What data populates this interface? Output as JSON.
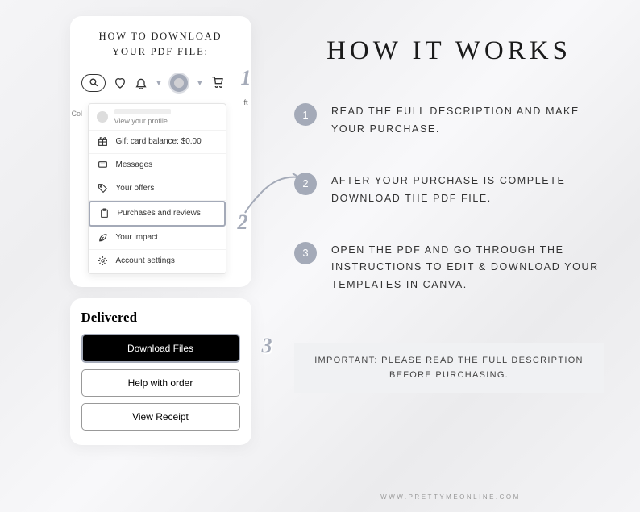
{
  "leftCard": {
    "title_line1": "HOW TO DOWNLOAD",
    "title_line2": "YOUR PDF FILE:",
    "behindText": "ift",
    "colLabel": "Col"
  },
  "dropdown": {
    "viewProfile": "View your profile",
    "giftCard": "Gift card balance: $0.00",
    "messages": "Messages",
    "offers": "Your offers",
    "purchases": "Purchases and reviews",
    "impact": "Your impact",
    "settings": "Account settings"
  },
  "delivered": {
    "title": "Delivered",
    "download": "Download Files",
    "help": "Help with order",
    "receipt": "View Receipt"
  },
  "main": {
    "title": "HOW IT WORKS",
    "steps": [
      "READ THE FULL DESCRIPTION AND MAKE YOUR PURCHASE.",
      "AFTER YOUR PURCHASE IS COMPLETE DOWNLOAD THE PDF FILE.",
      "OPEN THE PDF AND GO THROUGH THE INSTRUCTIONS TO EDIT & DOWNLOAD YOUR TEMPLATES IN CANVA."
    ],
    "important": "IMPORTANT: PLEASE READ THE FULL DESCRIPTION BEFORE PURCHASING."
  },
  "footer": "WWW.PRETTYMEONLINE.COM",
  "badges": {
    "one": "1",
    "two": "2",
    "three": "3"
  }
}
